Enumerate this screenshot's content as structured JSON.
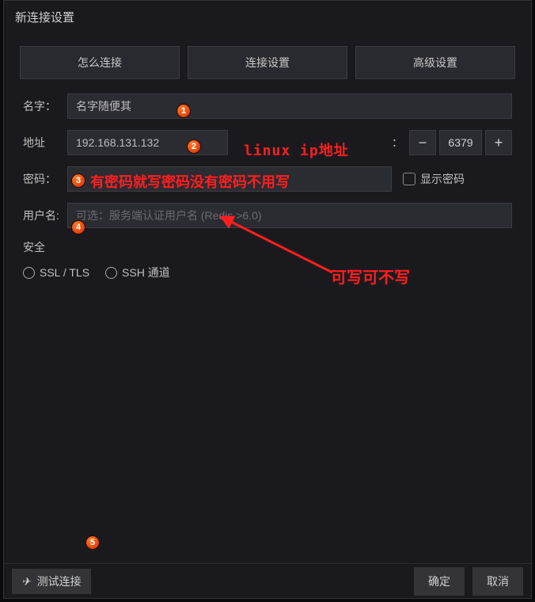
{
  "window": {
    "title": "新连接设置"
  },
  "tabs": [
    {
      "label": "怎么连接"
    },
    {
      "label": "连接设置"
    },
    {
      "label": "高级设置"
    }
  ],
  "fields": {
    "name": {
      "label": "名字：",
      "value": "名字随便其"
    },
    "address": {
      "label": "地址",
      "value": "192.168.131.132"
    },
    "port": {
      "separator": "：",
      "minus": "−",
      "value": "6379",
      "plus": "+"
    },
    "password": {
      "label": "密码：",
      "value": "",
      "show_label": "显示密码"
    },
    "username": {
      "label": "用户名:",
      "placeholder": "可选：服务端认证用户名 (Redis >6.0)"
    }
  },
  "security": {
    "label": "安全",
    "ssl_label": "SSL / TLS",
    "ssh_label": "SSH 通道"
  },
  "footer": {
    "test": "测试连接",
    "ok": "确定",
    "cancel": "取消"
  },
  "annotations": {
    "badge1": "1",
    "badge2": "2",
    "badge3": "3",
    "badge4": "4",
    "badge5": "5",
    "ip_note": "linux ip地址",
    "pwd_note": "有密码就写密码没有密码不用写",
    "user_note": "可写可不写"
  }
}
